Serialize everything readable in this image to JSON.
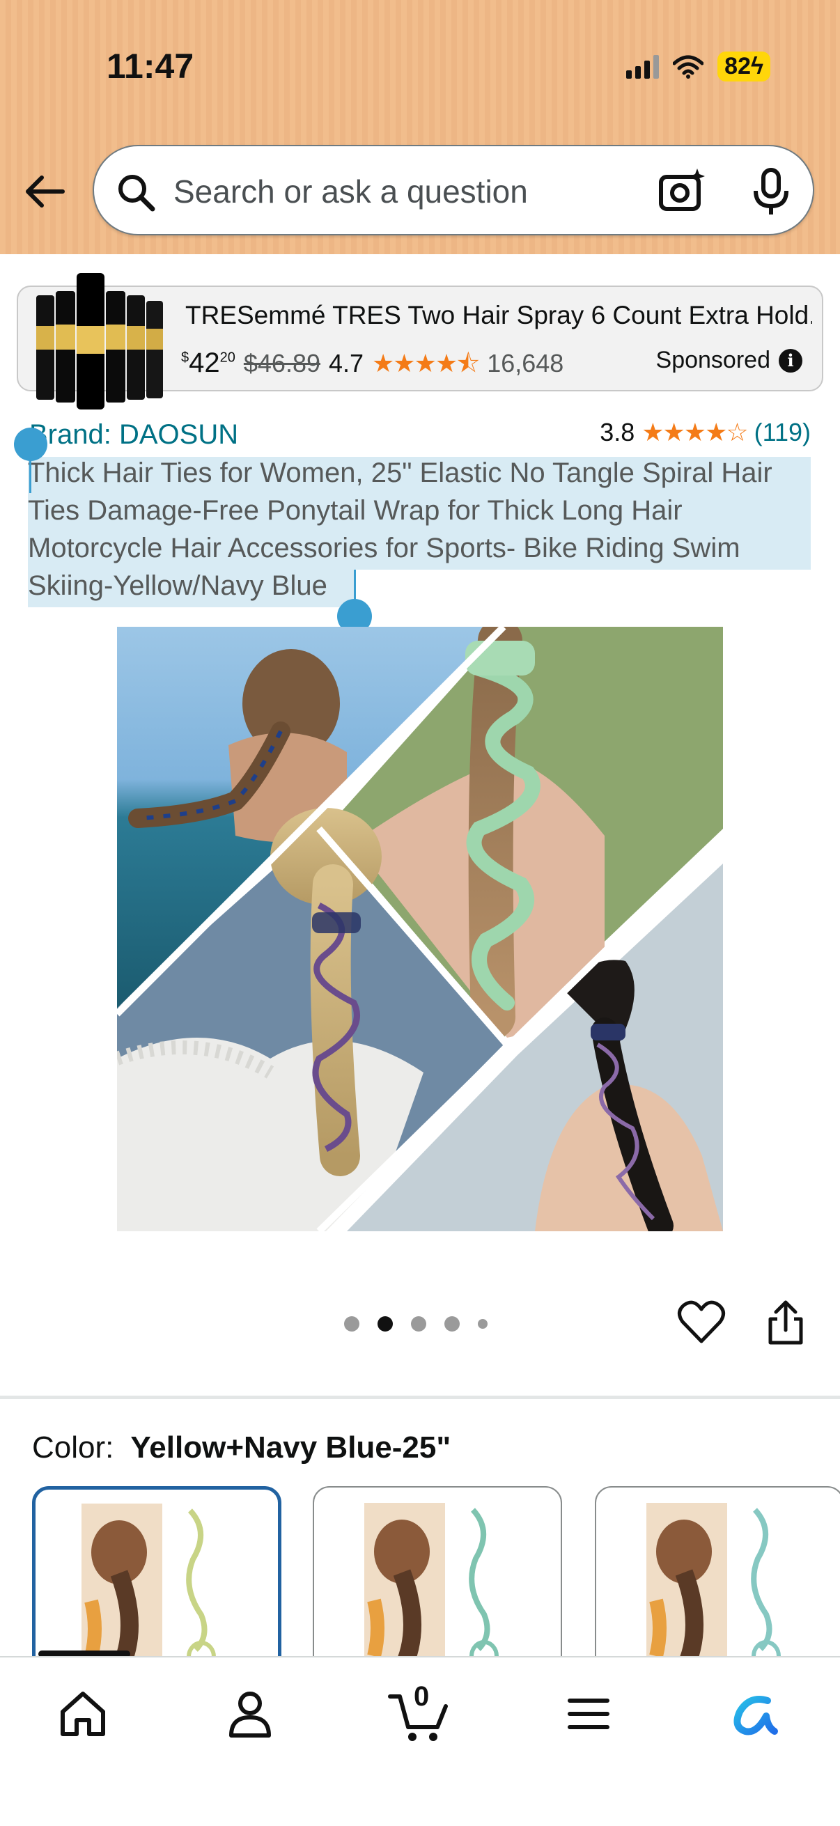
{
  "status_bar": {
    "time": "11:47",
    "battery": "82"
  },
  "search": {
    "placeholder": "Search or ask a question"
  },
  "sponsored_ad": {
    "title": "TRESemmé TRES Two Hair Spray 6 Count Extra Hold...",
    "price_currency": "$",
    "price_whole": "42",
    "price_fraction": "20",
    "list_price": "$46.89",
    "rating": "4.7",
    "stars": "★★★★⯪",
    "review_count": "16,648",
    "label": "Sponsored",
    "info_glyph": "i"
  },
  "product": {
    "brand": "Brand: DAOSUN",
    "rating": "3.8",
    "stars": "★★★★☆",
    "review_count": "(119)",
    "title": "Thick Hair Ties for Women, 25\" Elastic No Tangle Spiral Hair Ties Damage-Free Ponytail Wrap for Thick Long Hair Motorcycle Hair Accessories for Sports- Bike Riding Swim Skiing-Yellow/Navy Blue",
    "image_pagination": {
      "count": 5,
      "active_index": 1
    }
  },
  "variation": {
    "color_label": "Color:",
    "color_value": "Yellow+Navy Blue-25\"",
    "swatches": [
      "Yellow+Navy Blue-25\"",
      "option-2",
      "option-3"
    ]
  },
  "bottom_nav": {
    "cart_count": "0",
    "items": [
      "home-icon",
      "account-icon",
      "cart-icon",
      "menu-icon",
      "rufus-icon"
    ]
  },
  "colors": {
    "header_bg": "#f1bd8c",
    "link": "#007185",
    "star": "#f47b17",
    "selection": "#d8ebf4",
    "selected_border": "#2162a1"
  }
}
